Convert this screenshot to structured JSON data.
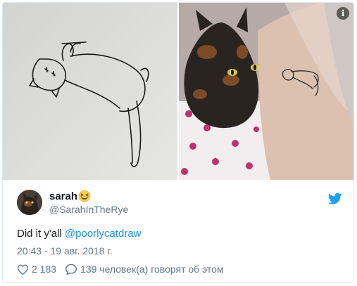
{
  "tweet": {
    "display_name": "sarah",
    "name_emoji": "grinning-squinting-face-emoji",
    "handle": "@SarahInTheRye",
    "text_prefix": "Did it y'all ",
    "mention": "@poorlycatdraw",
    "timestamp": "20:43 - 19 авг. 2018 г.",
    "likes": "2 183",
    "replies_text": "139 человек(а) говорят об этом"
  },
  "media": {
    "left_image": "poorly-drawn-cat-sketch",
    "right_image": "tortoiseshell-cat-and-arm-tattoo",
    "info_glyph": "i"
  },
  "colors": {
    "link": "#1b95e0",
    "text": "#14171a",
    "secondary": "#657786",
    "border": "#e1e8ed",
    "twitter_blue": "#1da1f2"
  },
  "icons": [
    "info-icon",
    "twitter-bird-icon",
    "heart-icon",
    "reply-bubble-icon"
  ]
}
